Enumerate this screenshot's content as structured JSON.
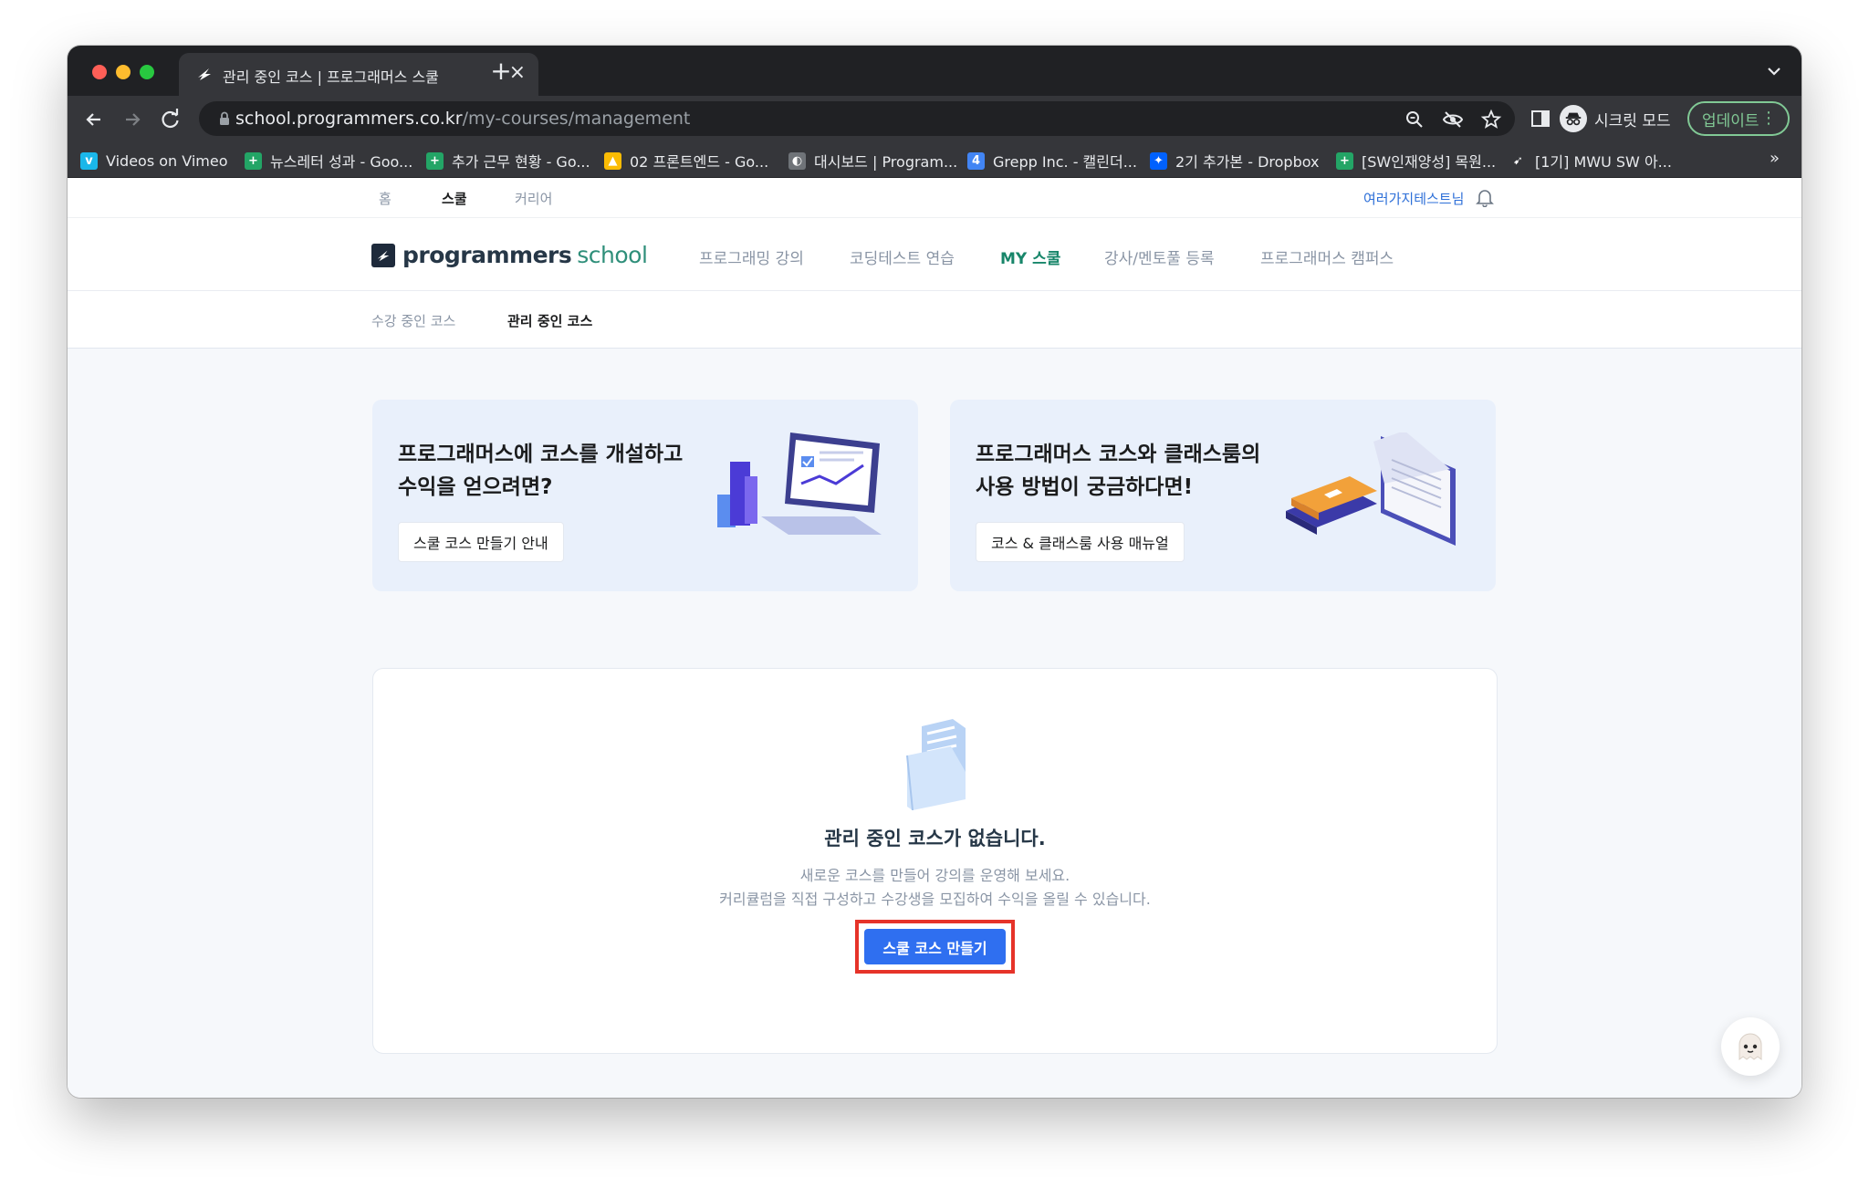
{
  "browser": {
    "tab_title": "관리 중인 코스 | 프로그래머스 스쿨",
    "url_host": "school.programmers.co.kr",
    "url_path": "/my-courses/management",
    "incognito_label": "시크릿 모드",
    "update_label": "업데이트",
    "bookmarks": [
      {
        "label": "Videos on Vimeo",
        "icon": "vimeo-icon",
        "color": "#1ab7ea",
        "glyph": "v"
      },
      {
        "label": "뉴스레터 성과 - Goo...",
        "icon": "google-sheets-icon",
        "color": "#23a566",
        "glyph": "+"
      },
      {
        "label": "추가 근무 현황 - Go...",
        "icon": "google-sheets-icon",
        "color": "#23a566",
        "glyph": "+"
      },
      {
        "label": "02 프론트엔드 - Go...",
        "icon": "google-drive-icon",
        "color": "#fbbc04",
        "glyph": "▲"
      },
      {
        "label": "대시보드 | Program...",
        "icon": "globe-icon",
        "color": "#6f7378",
        "glyph": "◐"
      },
      {
        "label": "Grepp Inc. - 캘린더...",
        "icon": "google-calendar-icon",
        "color": "#4285f4",
        "glyph": "4"
      },
      {
        "label": "2기 추가본 - Dropbox",
        "icon": "dropbox-icon",
        "color": "#0061fe",
        "glyph": "✦"
      },
      {
        "label": "[SW인재양성] 목원...",
        "icon": "google-sheets-icon",
        "color": "#23a566",
        "glyph": "+"
      },
      {
        "label": "[1기] MWU SW 아...",
        "icon": "programmers-icon",
        "color": "#35363a",
        "glyph": "➹"
      }
    ],
    "bookmarks_more": "»"
  },
  "gnb": {
    "items": [
      "홈",
      "스쿨",
      "커리어"
    ],
    "active_index": 1,
    "user": "여러가지테스트님"
  },
  "header": {
    "logo_main": "programmers",
    "logo_sub": "school",
    "menu": [
      "프로그래밍 강의",
      "코딩테스트 연습",
      "MY 스쿨",
      "강사/멘토풀 등록",
      "프로그래머스 캠퍼스"
    ],
    "active_index": 2
  },
  "subnav": {
    "tabs": [
      "수강 중인 코스",
      "관리 중인 코스"
    ],
    "active_index": 1
  },
  "promos": [
    {
      "title_line1": "프로그래머스에 코스를 개설하고",
      "title_line2": "수익을 얻으려면?",
      "button": "스쿨 코스 만들기 안내"
    },
    {
      "title_line1": "프로그래머스 코스와 클래스룸의",
      "title_line2": "사용 방법이 궁금하다면!",
      "button": "코스 & 클래스룸 사용 매뉴얼"
    }
  ],
  "empty_state": {
    "title": "관리 중인 코스가 없습니다.",
    "desc_line1": "새로운 코스를 만들어 강의를 운영해 보세요.",
    "desc_line2": "커리큘럼을 직접 구성하고 수강생을 모집하여 수익을 올릴 수 있습니다.",
    "cta": "스쿨 코스 만들기"
  },
  "colors": {
    "accent_blue": "#2f6ff0",
    "highlight_red": "#e63329",
    "brand_green": "#18866a"
  }
}
